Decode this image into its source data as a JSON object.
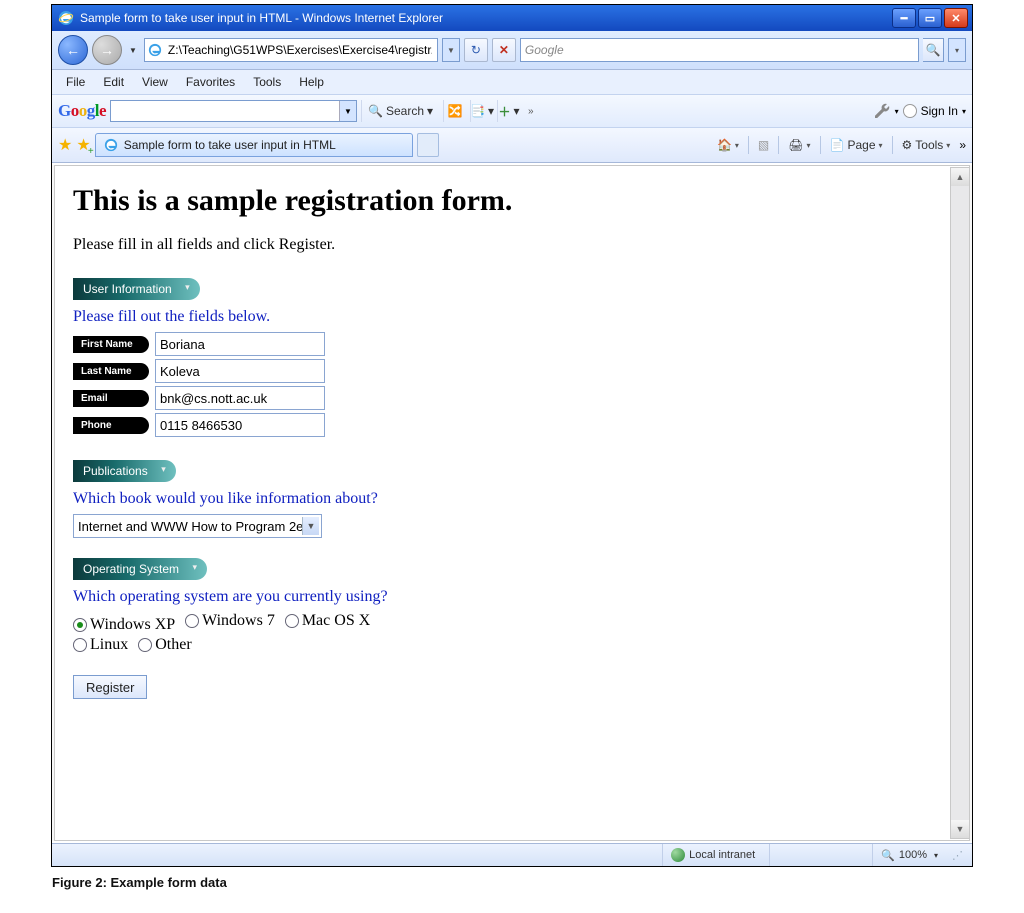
{
  "window": {
    "title": "Sample form to take user input in HTML - Windows Internet Explorer"
  },
  "nav": {
    "address": "Z:\\Teaching\\G51WPS\\Exercises\\Exercise4\\registr.",
    "search_placeholder": "Google"
  },
  "menu": {
    "file": "File",
    "edit": "Edit",
    "view": "View",
    "favorites": "Favorites",
    "tools": "Tools",
    "help": "Help"
  },
  "gtoolbar": {
    "search_label": "Search",
    "more_label": "»",
    "signin_label": "Sign In"
  },
  "tabs": {
    "tab0": "Sample form to take user input in HTML",
    "page_label": "Page",
    "tools_label": "Tools",
    "more": "»"
  },
  "page": {
    "heading": "This is a sample registration form.",
    "intro": "Please fill in all fields and click Register.",
    "legend_user": "User Information",
    "user_hint": "Please fill out the fields below.",
    "labels": {
      "first": "First Name",
      "last": "Last Name",
      "email": "Email",
      "phone": "Phone"
    },
    "values": {
      "first": "Boriana",
      "last": "Koleva",
      "email": "bnk@cs.nott.ac.uk",
      "phone": "0115 8466530"
    },
    "legend_pub": "Publications",
    "pub_q": "Which book would you like information about?",
    "pub_selected": "Internet and WWW How to Program 2e",
    "legend_os": "Operating System",
    "os_q": "Which operating system are you currently using?",
    "os": {
      "xp": "Windows XP",
      "w7": "Windows 7",
      "mac": "Mac OS X",
      "linux": "Linux",
      "other": "Other"
    },
    "register": "Register"
  },
  "status": {
    "zone": "Local intranet",
    "zoom": "100%"
  },
  "caption": "Figure 2: Example form data"
}
